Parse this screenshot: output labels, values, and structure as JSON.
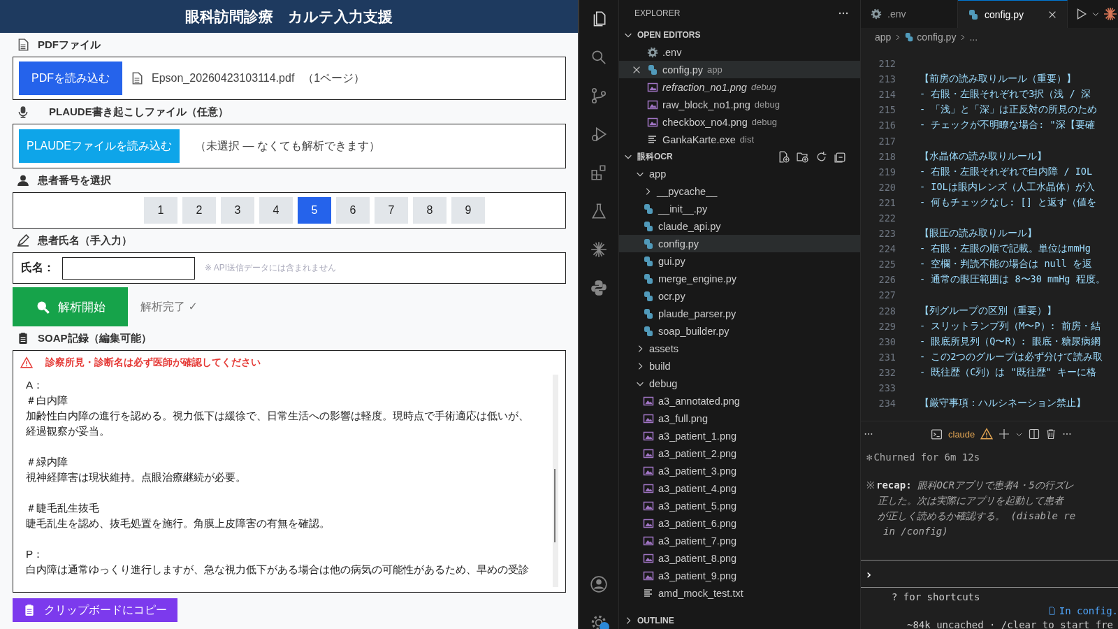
{
  "app": {
    "title": "眼科訪問診療　カルテ入力支援",
    "pdf": {
      "label": "PDFファイル",
      "button": "PDFを読み込む",
      "file": "Epson_20260423103114.pdf",
      "pages": "（1ページ）"
    },
    "plaude": {
      "label": "PLAUDE書き起こしファイル（任意）",
      "button": "PLAUDEファイルを読み込む",
      "status": "（未選択 — なくても解析できます）"
    },
    "patient": {
      "label": "患者番号を選択",
      "numbers": [
        {
          "label": "1",
          "selected": false
        },
        {
          "label": "2",
          "selected": false
        },
        {
          "label": "3",
          "selected": false
        },
        {
          "label": "4",
          "selected": false
        },
        {
          "label": "5",
          "selected": true
        },
        {
          "label": "6",
          "selected": false
        },
        {
          "label": "7",
          "selected": false
        },
        {
          "label": "8",
          "selected": false
        },
        {
          "label": "9",
          "selected": false
        }
      ]
    },
    "name": {
      "label": "患者氏名（手入力）",
      "field_label": "氏名：",
      "note": "※ API送信データには含まれません"
    },
    "analyze": {
      "button": "解析開始",
      "status": "解析完了 ✓"
    },
    "soap": {
      "label": "SOAP記録（編集可能）",
      "warning": "診察所見・診断名は必ず医師が確認してください",
      "paragraphs": [
        [
          "A：",
          "＃白内障",
          "加齢性白内障の進行を認める。視力低下は緩徐で、日常生活への影響は軽度。現時点で手術適応は低いが、経過観察が妥当。"
        ],
        [
          "＃緑内障",
          "視神経障害は現状維持。点眼治療継続が必要。"
        ],
        [
          "＃睫毛乱生抜毛",
          "睫毛乱生を認め、抜毛処置を施行。角膜上皮障害の有無を確認。"
        ],
        [
          "P：",
          "白内障は通常ゆっくり進行しますが、急な視力低下がある場合は他の病気の可能性があるため、早めの受診"
        ]
      ]
    },
    "copy_button": "クリップボードにコピー"
  },
  "vscode": {
    "activity_bar": [
      {
        "selected": true
      },
      {
        "selected": false
      },
      {
        "selected": false
      },
      {
        "selected": false
      },
      {
        "selected": false
      },
      {
        "selected": false
      },
      {
        "selected": false
      },
      {
        "selected": false
      }
    ],
    "explorer": {
      "title": "EXPLORER",
      "open_editors": {
        "title": "OPEN EDITORS",
        "expanded": true,
        "items": [
          {
            "kind": "settings",
            "name": ".env",
            "selected": false,
            "preview": false
          },
          {
            "kind": "python",
            "name": "config.py",
            "folder": "app",
            "selected": true,
            "preview": false
          },
          {
            "kind": "image",
            "name": "refraction_no1.png",
            "folder": "debug",
            "selected": false,
            "preview": true
          },
          {
            "kind": "image",
            "name": "raw_block_no1.png",
            "folder": "debug",
            "selected": false,
            "preview": false
          },
          {
            "kind": "image",
            "name": "checkbox_no4.png",
            "folder": "debug",
            "selected": false,
            "preview": false
          },
          {
            "kind": "text",
            "name": "GankaKarte.exe",
            "folder": "dist",
            "selected": false,
            "preview": false
          }
        ]
      },
      "workspace": {
        "title": "眼科OCR",
        "expanded": true,
        "children": [
          {
            "kind": "folder",
            "name": "app",
            "expanded": true,
            "selected": false,
            "children": [
              {
                "kind": "folder",
                "name": "__pycache__",
                "expanded": false,
                "selected": false
              },
              {
                "kind": "python",
                "name": "__init__.py",
                "selected": false
              },
              {
                "kind": "python",
                "name": "claude_api.py",
                "selected": false
              },
              {
                "kind": "python",
                "name": "config.py",
                "selected": true
              },
              {
                "kind": "python",
                "name": "gui.py",
                "selected": false
              },
              {
                "kind": "python",
                "name": "merge_engine.py",
                "selected": false
              },
              {
                "kind": "python",
                "name": "ocr.py",
                "selected": false
              },
              {
                "kind": "python",
                "name": "plaude_parser.py",
                "selected": false
              },
              {
                "kind": "python",
                "name": "soap_builder.py",
                "selected": false
              }
            ]
          },
          {
            "kind": "folder",
            "name": "assets",
            "expanded": false,
            "selected": false
          },
          {
            "kind": "folder",
            "name": "build",
            "expanded": false,
            "selected": false
          },
          {
            "kind": "folder",
            "name": "debug",
            "expanded": true,
            "selected": false,
            "children": [
              {
                "kind": "image",
                "name": "a3_annotated.png",
                "selected": false
              },
              {
                "kind": "image",
                "name": "a3_full.png",
                "selected": false
              },
              {
                "kind": "image",
                "name": "a3_patient_1.png",
                "selected": false
              },
              {
                "kind": "image",
                "name": "a3_patient_2.png",
                "selected": false
              },
              {
                "kind": "image",
                "name": "a3_patient_3.png",
                "selected": false
              },
              {
                "kind": "image",
                "name": "a3_patient_4.png",
                "selected": false
              },
              {
                "kind": "image",
                "name": "a3_patient_5.png",
                "selected": false
              },
              {
                "kind": "image",
                "name": "a3_patient_6.png",
                "selected": false
              },
              {
                "kind": "image",
                "name": "a3_patient_7.png",
                "selected": false
              },
              {
                "kind": "image",
                "name": "a3_patient_8.png",
                "selected": false
              },
              {
                "kind": "image",
                "name": "a3_patient_9.png",
                "selected": false
              },
              {
                "kind": "text",
                "name": "amd_mock_test.txt",
                "selected": false
              }
            ]
          }
        ]
      },
      "outline": {
        "title": "OUTLINE",
        "expanded": false
      }
    },
    "tabs": [
      {
        "kind": "settings",
        "label": ".env",
        "selected": false
      },
      {
        "kind": "python",
        "label": "config.py",
        "selected": true
      }
    ],
    "breadcrumb": [
      "app",
      "config.py",
      "..."
    ],
    "lines": [
      {
        "number": "212"
      },
      {
        "number": "213",
        "text": "【前房の読み取りルール（重要）】"
      },
      {
        "number": "214",
        "text": "- 右眼・左眼それぞれで3択（浅 / 深"
      },
      {
        "number": "215",
        "text": "- 「浅」と「深」は正反対の所見のため"
      },
      {
        "number": "216",
        "text": "- チェックが不明瞭な場合: \"深【要確"
      },
      {
        "number": "217"
      },
      {
        "number": "218",
        "text": "【水晶体の読み取りルール】"
      },
      {
        "number": "219",
        "text": "- 右眼・左眼それぞれで白内障 / IOL"
      },
      {
        "number": "220",
        "text": "- IOLは眼内レンズ（人工水晶体）が入"
      },
      {
        "number": "221",
        "text": "- 何もチェックなし: [] と返す（値を"
      },
      {
        "number": "222"
      },
      {
        "number": "223",
        "text": "【眼圧の読み取りルール】"
      },
      {
        "number": "224",
        "text": "- 右眼・左眼の順で記載。単位はmmHg"
      },
      {
        "number": "225",
        "text": "- 空欄・判読不能の場合は null を返"
      },
      {
        "number": "226",
        "text": "- 通常の眼圧範囲は 8〜30 mmHg 程度。"
      },
      {
        "number": "227"
      },
      {
        "number": "228",
        "text": "【列グループの区別（重要）】"
      },
      {
        "number": "229",
        "text": "- スリットランプ列（M〜P）: 前房・結"
      },
      {
        "number": "230",
        "text": "- 眼底所見列（Q〜R）: 眼底・糖尿病網"
      },
      {
        "number": "231",
        "text": "- この2つのグループは必ず分けて読み取"
      },
      {
        "number": "232",
        "text": "- 既往歴（C列）は \"既往歴\" キーに格"
      },
      {
        "number": "233"
      },
      {
        "number": "234",
        "text": "【厳守事項：ハルシネーション禁止】"
      }
    ],
    "terminal": {
      "title": "claude",
      "churned": {
        "mark": "✻",
        "text": "Churned for 6m 12s"
      },
      "recap": {
        "mark": "※",
        "label": "recap:",
        "lines": [
          "眼科OCRアプリで患者4・5の行ズレ",
          "正した。次は実際にアプリを起動して患者",
          "が正しく読めるか確認する。 (disable re",
          "in /config)"
        ]
      },
      "prompt": "›",
      "hint": "? for shortcuts",
      "context": "In config.",
      "usage": "~84k uncached · /clear to start fre"
    }
  }
}
